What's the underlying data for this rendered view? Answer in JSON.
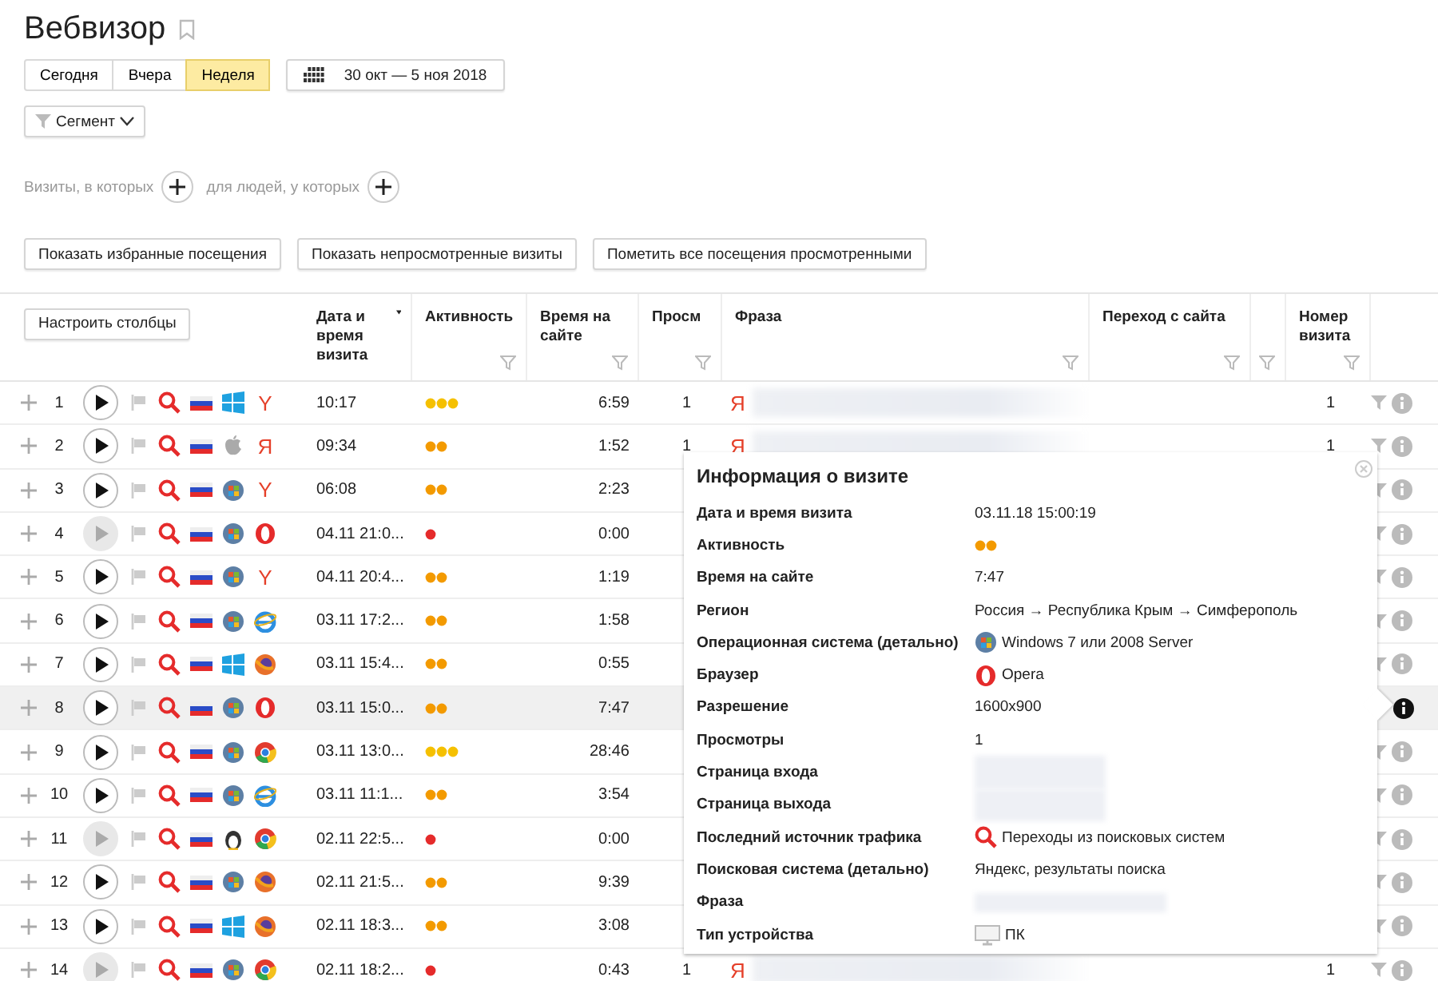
{
  "title": "Вебвизор",
  "periods": [
    {
      "label": "Сегодня",
      "selected": false
    },
    {
      "label": "Вчера",
      "selected": false
    },
    {
      "label": "Неделя",
      "selected": true
    }
  ],
  "date_range": "30 окт — 5 ноя 2018",
  "segment": "Сегмент",
  "filters": [
    "Визиты, в которых",
    "для людей, у которых"
  ],
  "actions": [
    "Показать избранные посещения",
    "Показать непросмотренные визиты",
    "Пометить все посещения просмотренными"
  ],
  "table": {
    "configure": "Настроить столбцы",
    "columns": [
      {
        "label": "Дата и время визита",
        "sorted": true,
        "filter": false
      },
      {
        "label": "Активность",
        "sorted": false,
        "filter": true
      },
      {
        "label": "Время на сайте",
        "sorted": false,
        "filter": true
      },
      {
        "label": "Просм",
        "sorted": false,
        "filter": true
      },
      {
        "label": "Фраза",
        "sorted": false,
        "filter": true
      },
      {
        "label": "Переход с сайта",
        "sorted": false,
        "filter": true
      },
      {
        "sorted": false,
        "filter": true
      },
      {
        "label": "Номер визита",
        "sorted": false,
        "filter": true
      }
    ],
    "rows": [
      {
        "n": "1",
        "playable": true,
        "selected": false,
        "os": {
          "kind": "windows10"
        },
        "browser": {
          "kind": "yandex",
          "glyph": "Y"
        },
        "date": "10:17",
        "activity": {
          "kind": "high"
        },
        "time": "6:59",
        "views": "1",
        "phrase_engine": "Я",
        "number": "1"
      },
      {
        "n": "2",
        "playable": true,
        "selected": false,
        "os": {
          "kind": "apple"
        },
        "browser": {
          "kind": "yandex",
          "glyph": "Я"
        },
        "date": "09:34",
        "activity": {
          "kind": "medium"
        },
        "time": "1:52",
        "views": "1",
        "phrase_engine": "Я",
        "number": "1"
      },
      {
        "n": "3",
        "playable": true,
        "selected": false,
        "os": {
          "kind": "windows7"
        },
        "browser": {
          "kind": "yandex",
          "glyph": "Y"
        },
        "date": "06:08",
        "activity": {
          "kind": "medium"
        },
        "time": "2:23"
      },
      {
        "n": "4",
        "playable": false,
        "selected": false,
        "os": {
          "kind": "windows7"
        },
        "browser": {
          "kind": "opera"
        },
        "date": "04.11 21:0...",
        "activity": {
          "kind": "low"
        },
        "time": "0:00"
      },
      {
        "n": "5",
        "playable": true,
        "selected": false,
        "os": {
          "kind": "windows7"
        },
        "browser": {
          "kind": "yandex",
          "glyph": "Y"
        },
        "date": "04.11 20:4...",
        "activity": {
          "kind": "medium"
        },
        "time": "1:19"
      },
      {
        "n": "6",
        "playable": true,
        "selected": false,
        "os": {
          "kind": "windows7"
        },
        "browser": {
          "kind": "ie"
        },
        "date": "03.11 17:2...",
        "activity": {
          "kind": "medium"
        },
        "time": "1:58"
      },
      {
        "n": "7",
        "playable": true,
        "selected": false,
        "os": {
          "kind": "windows10"
        },
        "browser": {
          "kind": "firefox"
        },
        "date": "03.11 15:4...",
        "activity": {
          "kind": "medium"
        },
        "time": "0:55"
      },
      {
        "n": "8",
        "playable": true,
        "selected": true,
        "os": {
          "kind": "windows7"
        },
        "browser": {
          "kind": "opera"
        },
        "date": "03.11 15:0...",
        "activity": {
          "kind": "medium"
        },
        "time": "7:47"
      },
      {
        "n": "9",
        "playable": true,
        "selected": false,
        "os": {
          "kind": "windows7"
        },
        "browser": {
          "kind": "chrome"
        },
        "date": "03.11 13:0...",
        "activity": {
          "kind": "high"
        },
        "time": "28:46"
      },
      {
        "n": "10",
        "playable": true,
        "selected": false,
        "os": {
          "kind": "windows7"
        },
        "browser": {
          "kind": "ie"
        },
        "date": "03.11 11:1...",
        "activity": {
          "kind": "medium"
        },
        "time": "3:54"
      },
      {
        "n": "11",
        "playable": false,
        "selected": false,
        "os": {
          "kind": "linux"
        },
        "browser": {
          "kind": "chrome"
        },
        "date": "02.11 22:5...",
        "activity": {
          "kind": "low"
        },
        "time": "0:00"
      },
      {
        "n": "12",
        "playable": true,
        "selected": false,
        "os": {
          "kind": "windows7"
        },
        "browser": {
          "kind": "firefox"
        },
        "date": "02.11 21:5...",
        "activity": {
          "kind": "medium"
        },
        "time": "9:39"
      },
      {
        "n": "13",
        "playable": true,
        "selected": false,
        "os": {
          "kind": "windows10"
        },
        "browser": {
          "kind": "firefox"
        },
        "date": "02.11 18:3...",
        "activity": {
          "kind": "medium"
        },
        "time": "3:08"
      },
      {
        "n": "14",
        "playable": false,
        "selected": false,
        "os": {
          "kind": "windows7"
        },
        "browser": {
          "kind": "chrome"
        },
        "date": "02.11 18:2...",
        "activity": {
          "kind": "low"
        },
        "time": "0:43",
        "views": "1",
        "phrase_engine": "Я",
        "number": "1"
      }
    ]
  },
  "popup": {
    "title": "Информация о визите",
    "fields": [
      {
        "label": "Дата и время визита",
        "kind": "text",
        "value": "03.11.18 15:00:19"
      },
      {
        "label": "Активность",
        "kind": "activity",
        "activity": {
          "kind": "medium"
        }
      },
      {
        "label": "Время на сайте",
        "kind": "text",
        "value": "7:47"
      },
      {
        "label": "Регион",
        "kind": "text",
        "value": "Россия → Республика Крым → Симферополь"
      },
      {
        "label": "Операционная система (детально)",
        "kind": "icon-text",
        "icon": {
          "kind": "windows7"
        },
        "value": "Windows 7 или 2008 Server"
      },
      {
        "label": "Браузер",
        "kind": "icon-text",
        "icon": {
          "kind": "opera"
        },
        "value": "Opera"
      },
      {
        "label": "Разрешение",
        "kind": "text",
        "value": "1600x900"
      },
      {
        "label": "Просмотры",
        "kind": "text",
        "value": "1"
      },
      {
        "label": "Страница входа",
        "kind": "redacted"
      },
      {
        "label": "Страница выхода",
        "kind": "redacted"
      },
      {
        "label": "Последний источник трафика",
        "kind": "icon-text",
        "icon": {
          "kind": "search"
        },
        "value": "Переходы из поисковых систем"
      },
      {
        "label": "Поисковая система (детально)",
        "kind": "text",
        "value": "Яндекс, результаты поиска"
      },
      {
        "label": "Фраза",
        "kind": "redacted-wide"
      },
      {
        "label": "Тип устройства",
        "kind": "icon-text",
        "icon": {
          "kind": "monitor"
        },
        "value": "ПК"
      }
    ]
  }
}
